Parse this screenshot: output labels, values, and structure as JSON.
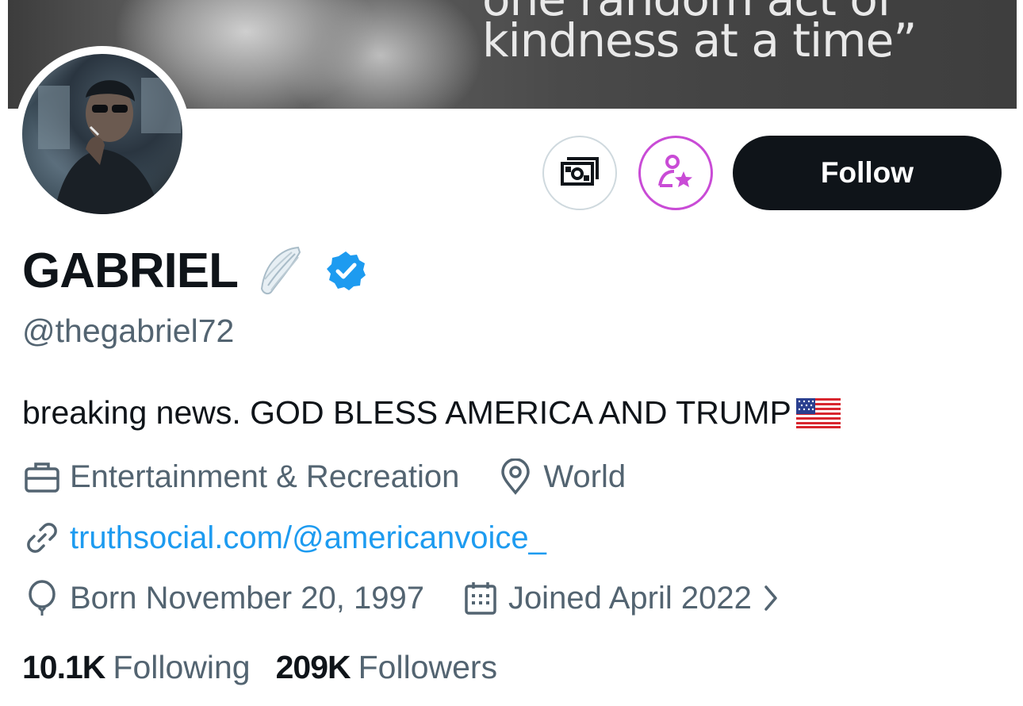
{
  "banner": {
    "quote_partial": "one random act of",
    "quote_line": "kindness at a time”"
  },
  "profile": {
    "display_name": "GABRIEL",
    "handle": "@thegabriel72",
    "bio": "breaking news. GOD BLESS AMERICA AND TRUMP",
    "category": "Entertainment & Recreation",
    "location": "World",
    "website": "truthsocial.com/@americanvoice_",
    "born": "Born November 20, 1997",
    "joined": "Joined April 2022"
  },
  "actions": {
    "follow_label": "Follow",
    "tip_icon": "money-icon",
    "subscribe_icon": "subscribe-star-icon"
  },
  "stats": {
    "following_count": "10.1K",
    "following_label": "Following",
    "followers_count": "209K",
    "followers_label": "Followers"
  },
  "colors": {
    "accent_link": "#1d9bf0",
    "verified_badge": "#1d9bf0",
    "subscribe_accent": "#c94bd6",
    "follow_button": "#0f1419",
    "muted_text": "#536471"
  }
}
